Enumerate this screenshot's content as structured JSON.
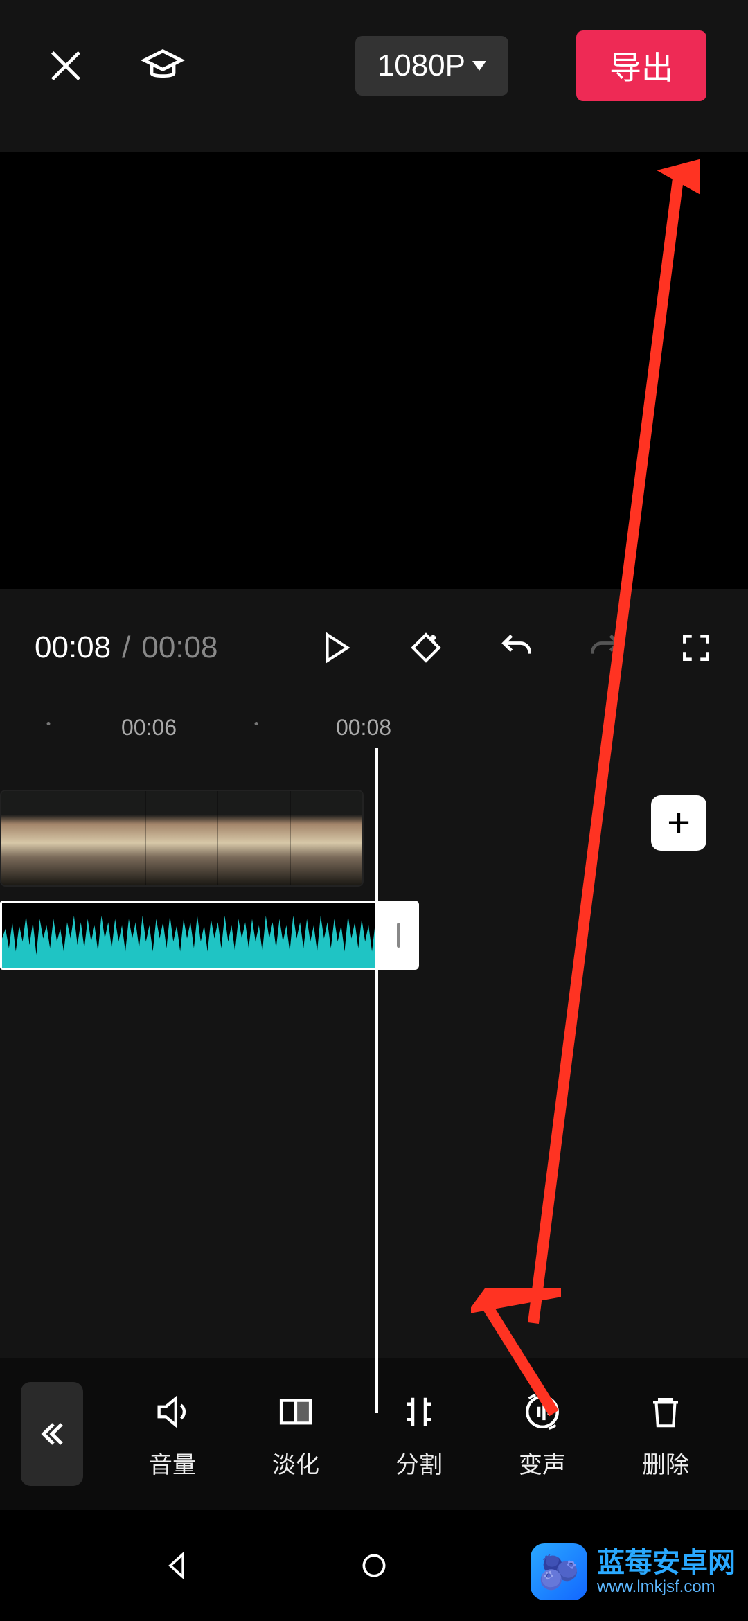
{
  "header": {
    "resolution_label": "1080P",
    "export_label": "导出"
  },
  "playback": {
    "current_time": "00:08",
    "separator": "/",
    "duration": "00:08"
  },
  "timeline": {
    "ruler_ticks": [
      "00:06",
      "00:08"
    ]
  },
  "tools": {
    "items": [
      {
        "icon": "volume-icon",
        "label": "音量"
      },
      {
        "icon": "fade-icon",
        "label": "淡化"
      },
      {
        "icon": "split-icon",
        "label": "分割"
      },
      {
        "icon": "voicechange-icon",
        "label": "变声"
      },
      {
        "icon": "delete-icon",
        "label": "删除"
      }
    ]
  },
  "watermark": {
    "title": "蓝莓安卓网",
    "url": "www.lmkjsf.com"
  },
  "icons": {
    "close": "close-icon",
    "tutorial": "graduation-cap-icon",
    "play": "play-icon",
    "keyframe": "add-keyframe-icon",
    "undo": "undo-icon",
    "redo": "redo-icon",
    "fullscreen": "fullscreen-icon",
    "add_clip": "plus-icon",
    "back": "chevron-double-left-icon"
  },
  "colors": {
    "accent": "#ee2a55",
    "waveform": "#1fc4c4"
  }
}
